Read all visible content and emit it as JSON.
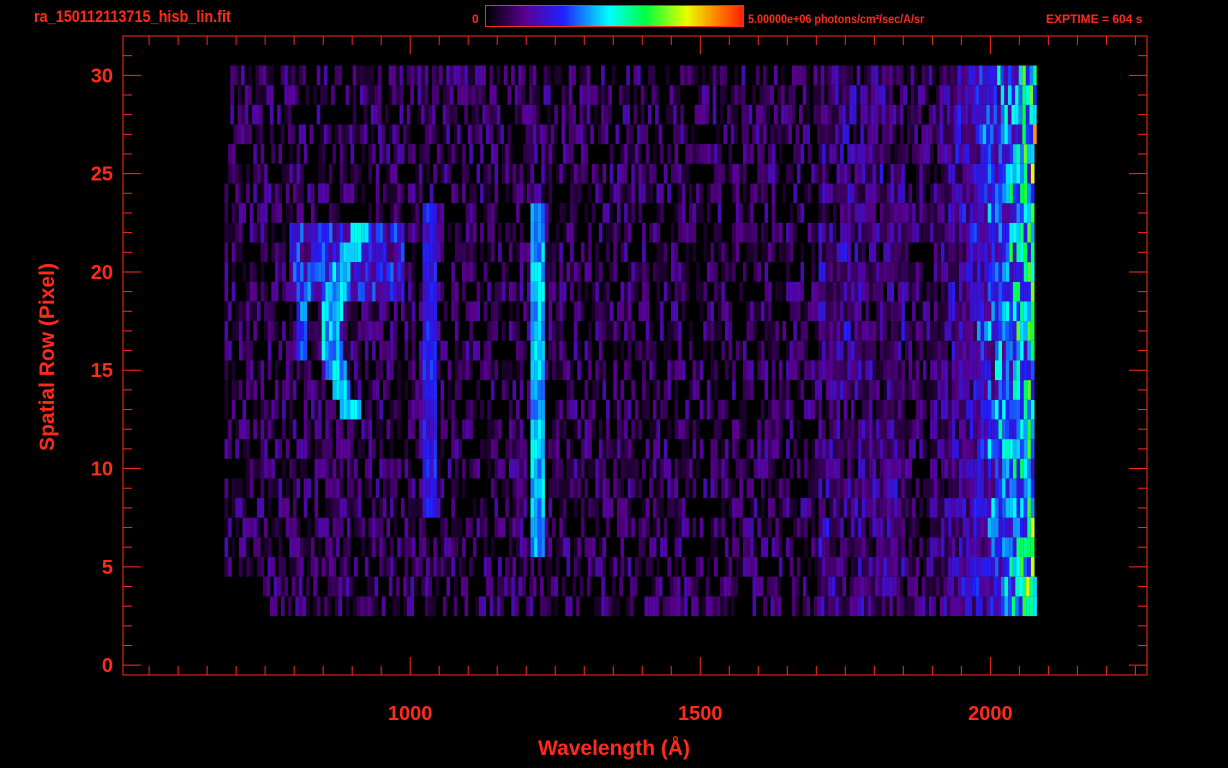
{
  "header": {
    "title": "ra_150112113715_hisb_lin.fit",
    "colorbar_min": "0",
    "colorbar_max": "5.00000e+06 photons/cm²/sec/A/sr",
    "exptime": "EXPTIME = 604 s"
  },
  "chart_data": {
    "type": "heatmap",
    "title": "ra_150112113715_hisb_lin.fit",
    "xlabel": "Wavelength (Å)",
    "ylabel": "Spatial Row (Pixel)",
    "xlim": [
      505,
      2270
    ],
    "ylim": [
      -0.5,
      32
    ],
    "x_ticks": [
      "1000",
      "1500",
      "2000"
    ],
    "x_tick_values": [
      1000,
      1500,
      2000
    ],
    "y_ticks": [
      "0",
      "5",
      "10",
      "15",
      "20",
      "25",
      "30"
    ],
    "y_tick_values": [
      0,
      5,
      10,
      15,
      20,
      25,
      30
    ],
    "colorbar_range": [
      0,
      5000000
    ],
    "colormap": "rainbow",
    "rows": [
      3,
      30
    ],
    "wavelength_coverage": [
      680,
      2075
    ],
    "features": [
      {
        "name": "arc",
        "wavelength_start": 800,
        "wavelength_end": 950,
        "rows": [
          13,
          22
        ],
        "level": 0.45
      },
      {
        "name": "line-1030",
        "wavelength": 1030,
        "rows": [
          8,
          23
        ],
        "level": 0.28
      },
      {
        "name": "line-1216",
        "wavelength": 1216,
        "rows": [
          6,
          23
        ],
        "level": 0.45
      },
      {
        "name": "red-end-rise",
        "wavelength_start": 1850,
        "wavelength_end": 2075,
        "rows": [
          3,
          30
        ],
        "level": 0.6
      }
    ]
  }
}
